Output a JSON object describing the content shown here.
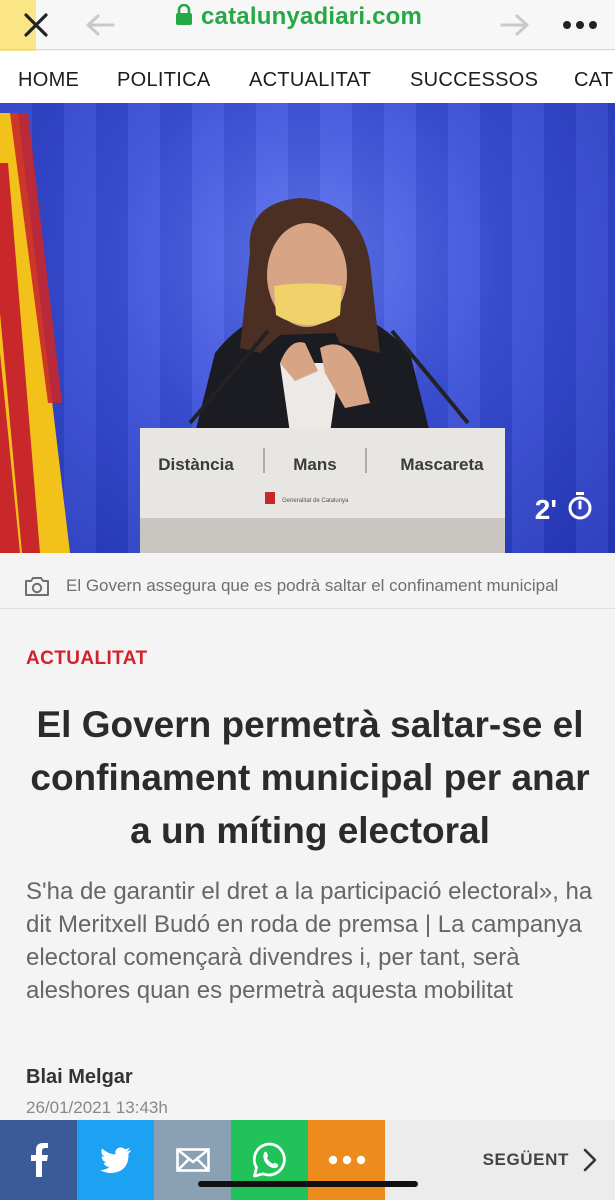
{
  "browser": {
    "url": "catalunyadiari.com",
    "close_icon": "close-icon",
    "back_icon": "back-arrow-icon",
    "forward_icon": "forward-arrow-icon",
    "more_icon": "more-dots-icon",
    "lock_icon": "lock-icon"
  },
  "nav": {
    "items": [
      "HOME",
      "POLITICA",
      "ACTUALITAT",
      "SUCCESSOS",
      "CAT"
    ]
  },
  "hero": {
    "podium_words": [
      "Distància",
      "Mans",
      "Mascareta"
    ],
    "podium_seal": "Generalitat de Catalunya",
    "reading_time": "2'",
    "timer_icon": "stopwatch-icon"
  },
  "caption": {
    "text": "El Govern assegura que es podrà saltar el confinament municipal",
    "icon": "camera-icon"
  },
  "article": {
    "section": "ACTUALITAT",
    "headline": "El Govern permetrà saltar-se el confinament municipal per anar a un míting electoral",
    "summary": "S'ha de garantir el dret a la participació electoral», ha dit Meritxell Budó en roda de premsa | La campanya electoral començarà divendres i, per tant, serà aleshores quan es permetrà aquesta mobilitat",
    "author": "Blai Melgar",
    "date": "26/01/2021 13:43h"
  },
  "share": {
    "next_label": "SEGÜENT",
    "colors": {
      "facebook": "#3b5b98",
      "twitter": "#1da1f2",
      "email": "#8aa0b3",
      "whatsapp": "#22c25a",
      "more": "#ee8b1d"
    }
  },
  "colors": {
    "url_green": "#26a845",
    "section_red": "#d3212b"
  }
}
